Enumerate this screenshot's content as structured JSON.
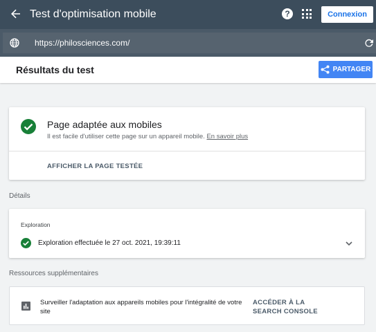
{
  "appbar": {
    "title": "Test d'optimisation mobile",
    "help_label": "?",
    "login_label": "Connexion"
  },
  "urlbar": {
    "url": "https://philosciences.com/"
  },
  "results": {
    "title": "Résultats du test",
    "share_label": "PARTAGER"
  },
  "result_card": {
    "heading": "Page adaptée aux mobiles",
    "description": "Il est facile d'utiliser cette page sur un appareil mobile.",
    "learn_more": "En savoir plus",
    "view_page": "AFFICHER LA PAGE TESTÉE"
  },
  "details": {
    "label": "Détails",
    "exploration_title": "Exploration",
    "exploration_status": "Exploration effectuée le 27 oct. 2021, 19:39:11"
  },
  "resources": {
    "label": "Ressources supplémentaires",
    "text": "Surveiller l'adaptation aux appareils mobiles pour l'intégralité de votre site",
    "link": "ACCÉDER À LA SEARCH CONSOLE"
  },
  "colors": {
    "appbar_bg": "#3c4d5c",
    "urlbar_bg": "#4b5a68",
    "share_blue": "#4285f4",
    "success_green": "#188038"
  },
  "icons": [
    "back-arrow-icon",
    "help-icon",
    "apps-grid-icon",
    "globe-icon",
    "reload-icon",
    "share-icon",
    "check-circle-icon",
    "chevron-down-icon",
    "bar-chart-icon"
  ]
}
